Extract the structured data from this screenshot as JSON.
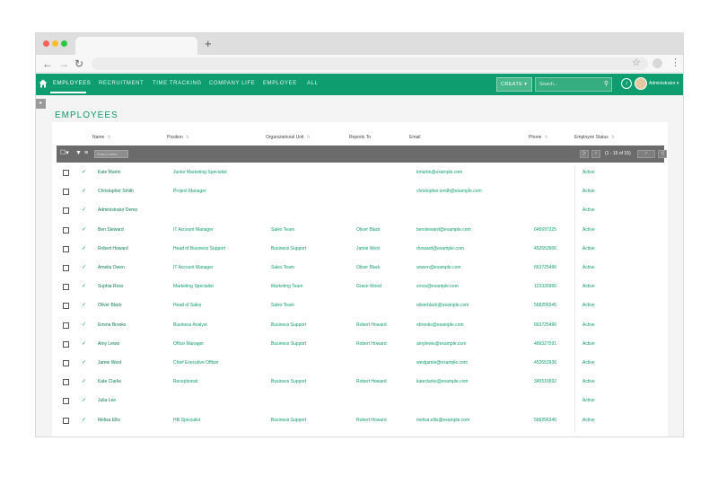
{
  "nav": {
    "items": [
      "EMPLOYEES",
      "RECRUITMENT",
      "TIME TRACKING",
      "COMPANY LIFE",
      "EMPLOYEE",
      "ALL"
    ],
    "create_label": "CREATE ▾",
    "search_placeholder": "Search...",
    "user_label": "Administrator ▾"
  },
  "page": {
    "title": "EMPLOYEES"
  },
  "table": {
    "columns": [
      "Name",
      "Position",
      "Organizational Unit",
      "Reports To",
      "Email",
      "Phone",
      "Employee Status"
    ],
    "search_placeholder": "Search table",
    "pagination": "(1 - 15 of 15)",
    "rows": [
      {
        "name": "Kate Martin",
        "position": "Junior Marketing Specialist",
        "unit": "",
        "reports": "",
        "email": "kmartin@example.com",
        "phone": "",
        "status": "Active"
      },
      {
        "name": "Christopher Smith",
        "position": "Project Manager",
        "unit": "",
        "reports": "",
        "email": "christopher.smith@example.com",
        "phone": "",
        "status": "Active"
      },
      {
        "name": "Administrator Demo",
        "position": "",
        "unit": "",
        "reports": "",
        "email": "",
        "phone": "",
        "status": "Active"
      },
      {
        "name": "Ben Steward",
        "position": "IT Account Manager",
        "unit": "Sales Team",
        "reports": "Oliver Black",
        "email": "bensteward@example.com",
        "phone": "645697325",
        "status": "Active"
      },
      {
        "name": "Robert Howard",
        "position": "Head of Business Support",
        "unit": "Business Support",
        "reports": "Jamie West",
        "email": "rhoward@example.com",
        "phone": "452653906",
        "status": "Active"
      },
      {
        "name": "Amelia Owen",
        "position": "IT Account Manager",
        "unit": "Sales Team",
        "reports": "Oliver Black",
        "email": "aowen@example.com",
        "phone": "663725496",
        "status": "Active"
      },
      {
        "name": "Sophia Ross",
        "position": "Marketing Specialist",
        "unit": "Marketing Team",
        "reports": "Grace Wood",
        "email": "sross@example.com",
        "phone": "123326966",
        "status": "Active"
      },
      {
        "name": "Oliver Black",
        "position": "Head of Sales",
        "unit": "Sales Team",
        "reports": "",
        "email": "oliverblack@example.com",
        "phone": "568256345",
        "status": "Active"
      },
      {
        "name": "Emma Brooks",
        "position": "Business Analyst",
        "unit": "Business Support",
        "reports": "Robert Howard",
        "email": "ebrooks@example.com",
        "phone": "663725496",
        "status": "Active"
      },
      {
        "name": "Amy Lewis",
        "position": "Office Manager",
        "unit": "Business Support",
        "reports": "Robert Howard",
        "email": "amylewis@example.com",
        "phone": "489327591",
        "status": "Active"
      },
      {
        "name": "Jamie West",
        "position": "Chief Executive Officer",
        "unit": "",
        "reports": "",
        "email": "westjamie@example.com",
        "phone": "452653936",
        "status": "Active"
      },
      {
        "name": "Kate Clarke",
        "position": "Receptionist",
        "unit": "Business Support",
        "reports": "Robert Howard",
        "email": "kateclarke@example.com",
        "phone": "345510692",
        "status": "Active"
      },
      {
        "name": "Julia Lee",
        "position": "",
        "unit": "",
        "reports": "",
        "email": "",
        "phone": "",
        "status": "Active"
      },
      {
        "name": "Melisa Ellis",
        "position": "HR Specialist",
        "unit": "Business Support",
        "reports": "Robert Howard",
        "email": "melisa.ellis@example.com",
        "phone": "568256345",
        "status": "Active"
      }
    ]
  },
  "colors": {
    "accent": "#0d9d6e",
    "toolbar": "#6b6b6b"
  }
}
